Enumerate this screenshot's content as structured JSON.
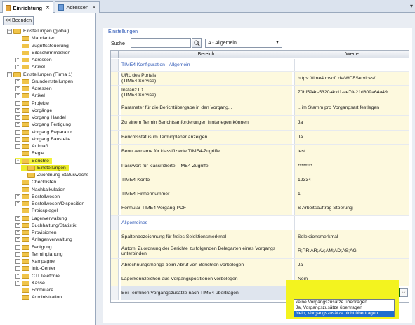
{
  "tabs": [
    {
      "label": "Einrichtung",
      "active": true,
      "icon": "folder-icon"
    },
    {
      "label": "Adressen",
      "active": false,
      "icon": "address-icon"
    }
  ],
  "left": {
    "back_label": "<< Beenden",
    "tree": [
      {
        "label": "Einstellungen (global)",
        "level": 0,
        "exp": "−"
      },
      {
        "label": "Mandanten",
        "level": 1,
        "exp": ""
      },
      {
        "label": "Zugriffssteuerung",
        "level": 1,
        "exp": ""
      },
      {
        "label": "Bildschirmmasken",
        "level": 1,
        "exp": ""
      },
      {
        "label": "Adressen",
        "level": 1,
        "exp": "+"
      },
      {
        "label": "Artikel",
        "level": 1,
        "exp": "+"
      },
      {
        "label": "Einstellungen (Firma 1)",
        "level": 0,
        "exp": "−"
      },
      {
        "label": "Grundeinstellungen",
        "level": 1,
        "exp": "+"
      },
      {
        "label": "Adressen",
        "level": 1,
        "exp": "+"
      },
      {
        "label": "Artikel",
        "level": 1,
        "exp": "+"
      },
      {
        "label": "Projekte",
        "level": 1,
        "exp": "+"
      },
      {
        "label": "Vorgänge",
        "level": 1,
        "exp": "+"
      },
      {
        "label": "Vorgang Handel",
        "level": 1,
        "exp": "+"
      },
      {
        "label": "Vorgang Fertigung",
        "level": 1,
        "exp": "+"
      },
      {
        "label": "Vorgang Reparatur",
        "level": 1,
        "exp": "+"
      },
      {
        "label": "Vorgang Baustelle",
        "level": 1,
        "exp": "+"
      },
      {
        "label": "Aufmaß",
        "level": 1,
        "exp": "+"
      },
      {
        "label": "Regie",
        "level": 1,
        "exp": ""
      },
      {
        "label": "Berichte",
        "level": 1,
        "exp": "−",
        "hl": true
      },
      {
        "label": "Einstellungen",
        "level": 2,
        "exp": "",
        "hl": true
      },
      {
        "label": "Zuordnung Statuswechs",
        "level": 2,
        "exp": ""
      },
      {
        "label": "Checklisten",
        "level": 1,
        "exp": ""
      },
      {
        "label": "Nachkalkulation",
        "level": 1,
        "exp": ""
      },
      {
        "label": "Bestellwesen",
        "level": 1,
        "exp": "+"
      },
      {
        "label": "Bestellwesen/Disposition",
        "level": 1,
        "exp": "+"
      },
      {
        "label": "Preisspiegel",
        "level": 1,
        "exp": ""
      },
      {
        "label": "Lagerverwaltung",
        "level": 1,
        "exp": "+"
      },
      {
        "label": "Buchhaltung/Statistik",
        "level": 1,
        "exp": "+"
      },
      {
        "label": "Provisionen",
        "level": 1,
        "exp": "+"
      },
      {
        "label": "Anlagenverwaltung",
        "level": 1,
        "exp": "+"
      },
      {
        "label": "Fertigung",
        "level": 1,
        "exp": "+"
      },
      {
        "label": "Terminplanung",
        "level": 1,
        "exp": "+"
      },
      {
        "label": "Kampagne",
        "level": 1,
        "exp": "+"
      },
      {
        "label": "Info-Center",
        "level": 1,
        "exp": "+"
      },
      {
        "label": "CTI Telefonie",
        "level": 1,
        "exp": "+"
      },
      {
        "label": "Kasse",
        "level": 1,
        "exp": "+"
      },
      {
        "label": "Formulare",
        "level": 1,
        "exp": ""
      },
      {
        "label": "Administration",
        "level": 1,
        "exp": ""
      }
    ]
  },
  "main": {
    "title": "Einstellungen",
    "search_label": "Suche",
    "search_value": "",
    "category": "A - Allgemein",
    "col_name": "Bereich",
    "col_value": "Werte",
    "rows": [
      {
        "name": "TIME4 Konfiguration - Allgemein",
        "value": "",
        "type": "section"
      },
      {
        "name": "URL des Portals\n(TIME4 Service)",
        "value": "https://time4.msoft.de/WCFServices/"
      },
      {
        "name": "Instanz ID\n(TIME4 Service)",
        "value": "70bf594c-5320-4dd1-ae70-21d809a64a49"
      },
      {
        "name": "Parameter für die Berichtübergabe in den Vorgang...",
        "value": "...im Stamm pro Vorgangsart festlegen"
      },
      {
        "name": "Zu einem Termin Berichtsanforderungen hinterlegen können",
        "value": "Ja"
      },
      {
        "name": "Berichtsstatus im Terminplaner anzeigen",
        "value": "Ja"
      },
      {
        "name": "Benutzername für klassifizierte TIME4-Zugriffe",
        "value": "test"
      },
      {
        "name": "Passwort für klassifizierte TIME4-Zugriffe",
        "value": "********"
      },
      {
        "name": "TIME4-Konto",
        "value": "12334"
      },
      {
        "name": "TIME4-Firmennummer",
        "value": "1"
      },
      {
        "name": "Formular TIME4 Vorgang-PDF",
        "value": "S   Arbeitsauftrag Stoerung"
      },
      {
        "name": "Allgemeines",
        "value": "",
        "type": "section"
      },
      {
        "name": "Spaltenbezeichnung für freies Selektionsmerkmal",
        "value": "Selektionsmerkmal"
      },
      {
        "name": "Autom. Zuordnung der Berichte zu folgenden Belegarten eines Vorgangs\nunterbinden",
        "value": "R;PR;AR;AV;AM;AD;AS;AG"
      },
      {
        "name": "Abrechnungsmenge beim Abruf von Berichten vorbelegen",
        "value": "Ja"
      },
      {
        "name": "Lagerkennzeichen aus Vorgangspositionen vorbelegen",
        "value": "Nein"
      },
      {
        "name": "Bei Terminen Vorgangszusätze nach TIME4 übertragen",
        "value": "keine Vorgangszusätze übertragen",
        "type": "selected"
      }
    ],
    "dropdown_options": [
      "keine Vorgangszusätze übertragen",
      "Ja, Vorgangszusätze übertragen",
      "Nein, Vorgangszusätze nicht übertragen"
    ],
    "dropdown_selected": 2
  },
  "colors": {
    "accent": "#2a55b5",
    "highlight": "#f2f23c",
    "combo_green": "#1fa21f",
    "row_alt": "#fdf9de"
  }
}
